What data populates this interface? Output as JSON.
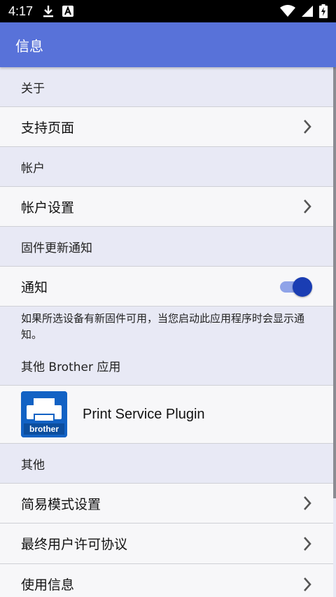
{
  "status_bar": {
    "time": "4:17",
    "icons_left": [
      "download-icon",
      "a-badge-icon"
    ],
    "icons_right": [
      "wifi-icon",
      "signal-icon",
      "battery-charging-icon"
    ]
  },
  "app_bar": {
    "title": "信息",
    "color": "#5872d9"
  },
  "sections": {
    "about": {
      "header": "关于",
      "items": [
        "支持页面"
      ]
    },
    "account": {
      "header": "帐户",
      "items": [
        "帐户设置"
      ]
    },
    "firmware": {
      "header": "固件更新通知",
      "toggle_label": "通知",
      "toggle_on": true,
      "note": "如果所选设备有新固件可用，当您启动此应用程序时会显示通知。"
    },
    "other_apps": {
      "header": "其他 Brother 应用",
      "plugin_name": "Print Service Plugin",
      "plugin_logo_text": "brother"
    },
    "other": {
      "header": "其他",
      "items": [
        "简易模式设置",
        "最终用户许可协议",
        "使用信息"
      ]
    }
  },
  "colors": {
    "accent": "#1a3db3",
    "background": "#e8e9f5",
    "row": "#f7f7f9"
  }
}
